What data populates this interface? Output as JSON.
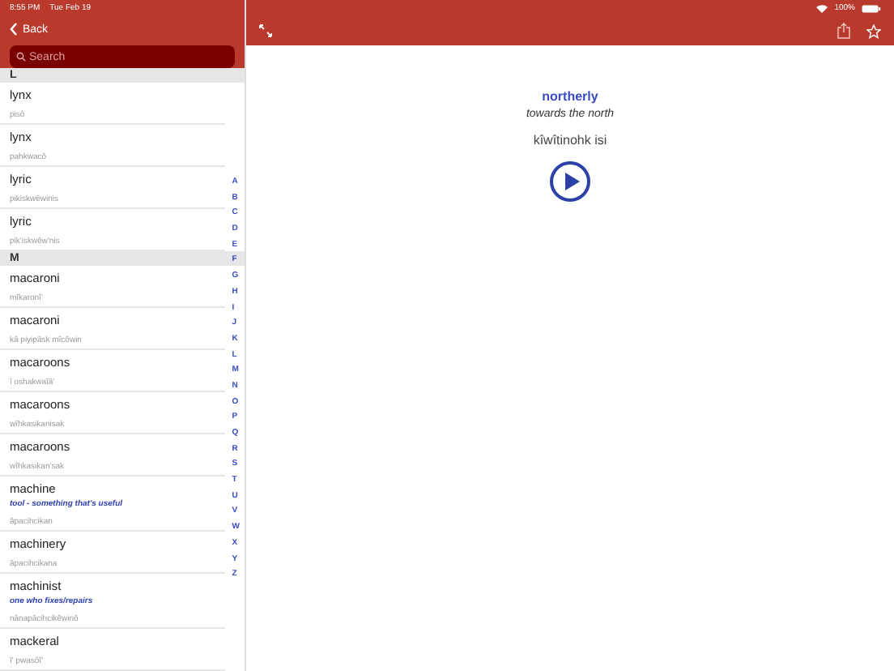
{
  "status_bar": {
    "time": "8:55 PM",
    "date": "Tue Feb 19",
    "battery": "100%"
  },
  "sidebar": {
    "back": "Back",
    "search": {
      "placeholder": "Search"
    },
    "sections": [
      {
        "letter": "L",
        "entries": [
          {
            "word": "lynx",
            "translation": "pisô"
          },
          {
            "word": "lynx",
            "translation": "pahkwacô"
          },
          {
            "word": "lyric",
            "translation": "pikiskwêwinis"
          },
          {
            "word": "lyric",
            "translation": "pik'iskwêw'nis"
          }
        ]
      },
      {
        "letter": "M",
        "entries": [
          {
            "word": "macaroni",
            "translation": "mîkaronî'"
          },
          {
            "word": "macaroni",
            "translation": "kâ piyipâsk mîcôwin"
          },
          {
            "word": "macaroons",
            "translation": "î oshakwaîâ'"
          },
          {
            "word": "macaroons",
            "translation": "wîhkasikanisak"
          },
          {
            "word": "macaroons",
            "translation": "wîhkasikan'sak"
          },
          {
            "word": "machine",
            "note": "tool - something that's useful",
            "translation": "âpacihcikan"
          },
          {
            "word": "machinery",
            "translation": "âpacihcikana"
          },
          {
            "word": "machinist",
            "note": "one who fixes/repairs",
            "translation": "nânapâcihcikêwinô"
          },
          {
            "word": "mackeral",
            "translation": "î' pwasôî'"
          }
        ]
      }
    ],
    "index": [
      "A",
      "B",
      "C",
      "D",
      "E",
      "F",
      "G",
      "H",
      "I",
      "J",
      "K",
      "L",
      "M",
      "N",
      "O",
      "P",
      "Q",
      "R",
      "S",
      "T",
      "U",
      "V",
      "W",
      "X",
      "Y",
      "Z"
    ]
  },
  "detail": {
    "word": "northerly",
    "definition": "towards the north",
    "translation": "kîwîtinohk isi"
  }
}
